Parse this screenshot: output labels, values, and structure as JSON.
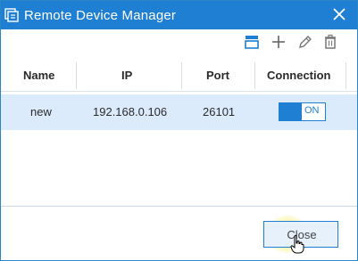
{
  "window": {
    "title": "Remote Device Manager"
  },
  "toolbar": {
    "icons": [
      "view-icon",
      "add-icon",
      "edit-icon",
      "delete-icon"
    ]
  },
  "table": {
    "columns": [
      "Name",
      "IP",
      "Port",
      "Connection"
    ],
    "rows": [
      {
        "name": "new",
        "ip": "192.168.0.106",
        "port": "26101",
        "connection": "ON"
      }
    ]
  },
  "footer": {
    "close_label": "Close"
  },
  "colors": {
    "accent": "#1e7fd3",
    "row_selected": "#dcebfb"
  }
}
